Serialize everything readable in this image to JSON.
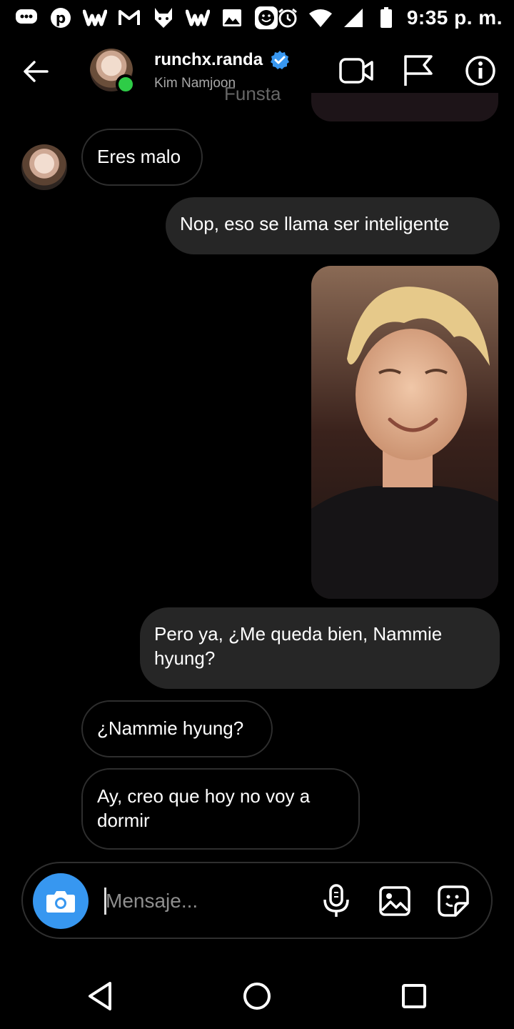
{
  "status_bar": {
    "time": "9:35 p. m.",
    "notification_icons": [
      "chat-bubble-icon",
      "pinterest-icon",
      "wattpad-icon",
      "gmail-icon",
      "fox-icon",
      "wattpad-icon",
      "image-icon",
      "smiley-icon"
    ],
    "system_icons": [
      "alarm-icon",
      "wifi-icon",
      "signal-icon",
      "battery-icon"
    ]
  },
  "header": {
    "username": "runchx.randa",
    "subtitle": "Kim Namjoon",
    "watermark": "Funsta",
    "online_color": "#2ecc47",
    "verified_color": "#3897f0"
  },
  "messages": [
    {
      "direction": "incoming",
      "text": "Eres malo"
    },
    {
      "direction": "outgoing",
      "text": "Nop, eso se llama ser inteligente"
    },
    {
      "direction": "outgoing",
      "type": "photo"
    },
    {
      "direction": "outgoing",
      "text": "Pero ya, ¿Me queda bien, Nammie hyung?"
    },
    {
      "direction": "incoming",
      "text": "¿Nammie hyung?"
    },
    {
      "direction": "incoming",
      "text": "Ay, creo que hoy no voy a dormir"
    }
  ],
  "composer": {
    "placeholder": "Mensaje...",
    "camera_color": "#3797f0"
  },
  "colors": {
    "background": "#000000",
    "outgoing_bubble": "#262626",
    "incoming_border": "#2e2e2e"
  }
}
